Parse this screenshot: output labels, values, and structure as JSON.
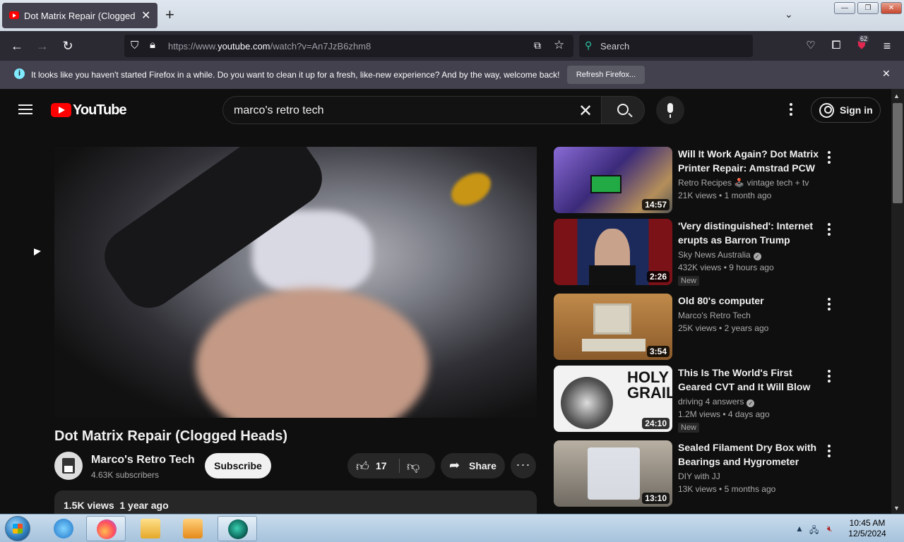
{
  "browser": {
    "tab_title": "Dot Matrix Repair (Clogged Heads) - YouTube",
    "url_prefix": "https://www.",
    "url_domain": "youtube.com",
    "url_path": "/watch?v=An7JzB6zhm8",
    "search_placeholder": "Search",
    "extensions_badge": "62",
    "notice_text": "It looks like you haven't started Firefox in a while. Do you want to clean it up for a fresh, like-new experience? And by the way, welcome back!",
    "notice_button": "Refresh Firefox..."
  },
  "youtube": {
    "logo_text": "YouTube",
    "search_query": "marco's retro tech",
    "signin_label": "Sign in",
    "video": {
      "title": "Dot Matrix Repair (Clogged Heads)",
      "channel": "Marco's Retro Tech",
      "subscribers": "4.63K subscribers",
      "subscribe_label": "Subscribe",
      "likes": "17",
      "share_label": "Share",
      "views_date": "1.5K views  1 year ago"
    },
    "recommendations": [
      {
        "title": "Will It Work Again? Dot Matrix Printer Repair: Amstrad PCW |...",
        "channel": "Retro Recipes 🕹️ vintage tech + tv",
        "views": "21K views",
        "age": "1 month ago",
        "duration": "14:57",
        "verified": false,
        "new": false
      },
      {
        "title": "'Very distinguished': Internet erupts as Barron Trump speak...",
        "channel": "Sky News Australia",
        "views": "432K views",
        "age": "9 hours ago",
        "duration": "2:26",
        "verified": true,
        "new": true,
        "new_label": "New"
      },
      {
        "title": "Old 80's computer",
        "channel": "Marco's Retro Tech",
        "views": "25K views",
        "age": "2 years ago",
        "duration": "3:54",
        "verified": false,
        "new": false
      },
      {
        "title": "This Is The World's First Geared CVT and It Will Blow Your Min...",
        "channel": "driving 4 answers",
        "views": "1.2M views",
        "age": "4 days ago",
        "duration": "24:10",
        "verified": true,
        "new": true,
        "new_label": "New"
      },
      {
        "title": "Sealed Filament Dry Box with Bearings and Hygrometer",
        "channel": "DIY with JJ",
        "views": "13K views",
        "age": "5 months ago",
        "duration": "13:10",
        "verified": false,
        "new": false
      }
    ]
  },
  "taskbar": {
    "time": "10:45 AM",
    "date": "12/5/2024"
  }
}
